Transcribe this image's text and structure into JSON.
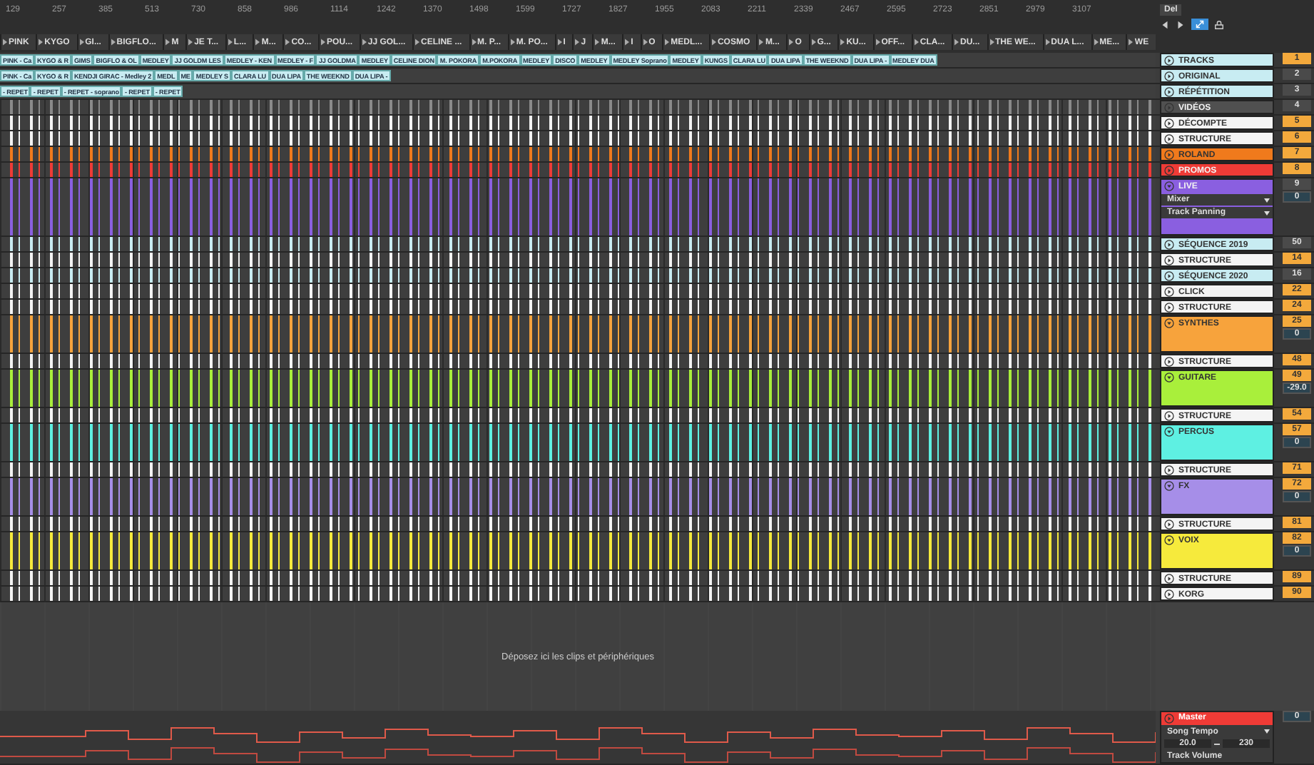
{
  "ruler": {
    "marks": [
      "129",
      "257",
      "385",
      "513",
      "730",
      "858",
      "986",
      "1114",
      "1242",
      "1370",
      "1498",
      "1599",
      "1727",
      "1827",
      "1955",
      "2083",
      "2211",
      "2339",
      "2467",
      "2595",
      "2723",
      "2851",
      "2979",
      "3107"
    ]
  },
  "locators": [
    "PINK",
    "KYGO",
    "GI...",
    "BIGFLO...",
    "M",
    "JE T...",
    "L...",
    "M...",
    "CO...",
    "POU...",
    "JJ GOL...",
    "CELINE ...",
    "M. P...",
    "M. PO...",
    "I",
    "J",
    "M...",
    "I",
    "O",
    "MEDL...",
    "COSMO",
    "M...",
    "O",
    "G...",
    "KU...",
    "OFF...",
    "CLA...",
    "DU...",
    "THE WE...",
    "DUA L...",
    "ME...",
    "WE"
  ],
  "panel_header": {
    "label": "Del"
  },
  "tracks": [
    {
      "name": "TRACKS",
      "color": "#c8ecf2",
      "kind": "audio",
      "expanded": false,
      "number": "1",
      "number_active": true,
      "clips": [
        "PINK - Ca",
        "KYGO & R",
        "GIMS",
        "BIGFLO & OL",
        "MEDLEY",
        "JJ GOLDM LES",
        "MEDLEY - KEN",
        "MEDLEY - F",
        "JJ GOLDMA",
        "MEDLEY",
        "CELINE DION",
        "M. POKORA",
        "M.POKORA",
        "MEDLEY",
        "DISCO",
        "MEDLEY",
        "MEDLEY Soprano",
        "MEDLEY",
        "KUNGS",
        "CLARA LU",
        "DUA LIPA",
        "THE WEEKND",
        "DUA LIPA -",
        "MEDLEY DUA"
      ]
    },
    {
      "name": "ORIGINAL",
      "color": "#c8ecf2",
      "kind": "audio",
      "expanded": false,
      "number": "2",
      "number_active": false,
      "clips": [
        "PINK - Ca",
        "KYGO & R",
        "KENDJI GIRAC - Medley 2",
        "MEDL",
        "ME",
        "MEDLEY S",
        "CLARA LU",
        "DUA LIPA",
        "THE WEEKND",
        "DUA LIPA -"
      ]
    },
    {
      "name": "RÉPÉTITION",
      "color": "#c8ecf2",
      "kind": "audio",
      "expanded": false,
      "number": "3",
      "number_active": false,
      "clips": [
        "- REPET",
        "- REPET",
        "- REPET - soprano",
        "- REPET",
        "- REPET"
      ]
    },
    {
      "name": "VIDÉOS",
      "color": "#505050",
      "kind": "audio",
      "expanded": false,
      "number": "4",
      "number_active": false
    },
    {
      "name": "DÉCOMPTE",
      "color": "#f4f4f4",
      "kind": "audio",
      "expanded": false,
      "number": "5",
      "number_active": true
    },
    {
      "name": "STRUCTURE",
      "color": "#f4f4f4",
      "kind": "audio",
      "expanded": false,
      "number": "6",
      "number_active": true
    },
    {
      "name": "ROLAND",
      "color": "#f07a1c",
      "kind": "audio",
      "expanded": false,
      "number": "7",
      "number_active": true
    },
    {
      "name": "PROMOS",
      "color": "#ef3b36",
      "kind": "audio",
      "expanded": false,
      "number": "8",
      "number_active": true
    },
    {
      "name": "LIVE",
      "color": "#8a5fe0",
      "kind": "audio",
      "expanded": true,
      "number": "9",
      "number_active": false,
      "volume": "0",
      "automation": {
        "device": "Mixer",
        "parameter": "Track Panning"
      }
    },
    {
      "name": "SÉQUENCE 2019",
      "color": "#c8ecf2",
      "kind": "audio",
      "expanded": false,
      "number": "50",
      "number_active": false
    },
    {
      "name": "STRUCTURE",
      "color": "#f4f4f4",
      "kind": "audio",
      "expanded": false,
      "number": "14",
      "number_active": true
    },
    {
      "name": "SÉQUENCE 2020",
      "color": "#c8ecf2",
      "kind": "audio",
      "expanded": false,
      "number": "16",
      "number_active": false
    },
    {
      "name": "CLICK",
      "color": "#f4f4f4",
      "kind": "audio",
      "expanded": false,
      "number": "22",
      "number_active": true
    },
    {
      "name": "STRUCTURE",
      "color": "#f4f4f4",
      "kind": "audio",
      "expanded": false,
      "number": "24",
      "number_active": true
    },
    {
      "name": "SYNTHES",
      "color": "#f7a33c",
      "kind": "group",
      "expanded": true,
      "number": "25",
      "number_active": true,
      "volume": "0"
    },
    {
      "name": "STRUCTURE",
      "color": "#f4f4f4",
      "kind": "audio",
      "expanded": false,
      "number": "48",
      "number_active": true
    },
    {
      "name": "GUITARE",
      "color": "#a9ef3b",
      "kind": "group",
      "expanded": true,
      "number": "49",
      "number_active": true,
      "volume": "-29.0"
    },
    {
      "name": "STRUCTURE",
      "color": "#f4f4f4",
      "kind": "audio",
      "expanded": false,
      "number": "54",
      "number_active": true
    },
    {
      "name": "PERCUS",
      "color": "#5ef0e2",
      "kind": "group",
      "expanded": true,
      "number": "57",
      "number_active": true,
      "volume": "0"
    },
    {
      "name": "STRUCTURE",
      "color": "#f4f4f4",
      "kind": "audio",
      "expanded": false,
      "number": "71",
      "number_active": true
    },
    {
      "name": "FX",
      "color": "#a68ee8",
      "kind": "group",
      "expanded": true,
      "number": "72",
      "number_active": true,
      "volume": "0"
    },
    {
      "name": "STRUCTURE",
      "color": "#f4f4f4",
      "kind": "audio",
      "expanded": false,
      "number": "81",
      "number_active": true
    },
    {
      "name": "VOIX",
      "color": "#f6ea3c",
      "kind": "group",
      "expanded": true,
      "number": "82",
      "number_active": true,
      "volume": "0"
    },
    {
      "name": "STRUCTURE",
      "color": "#f4f4f4",
      "kind": "audio",
      "expanded": false,
      "number": "89",
      "number_active": true
    },
    {
      "name": "KORG",
      "color": "#f4f4f4",
      "kind": "audio",
      "expanded": false,
      "number": "90",
      "number_active": true
    }
  ],
  "drop_hint": "Déposez ici les clips et périphériques",
  "master": {
    "name": "Master",
    "color": "#ef3b36",
    "expanded": false,
    "parameter": "Song Tempo",
    "min": "20.0",
    "max": "230",
    "lane_label": "Track Volume",
    "volume": "0"
  }
}
